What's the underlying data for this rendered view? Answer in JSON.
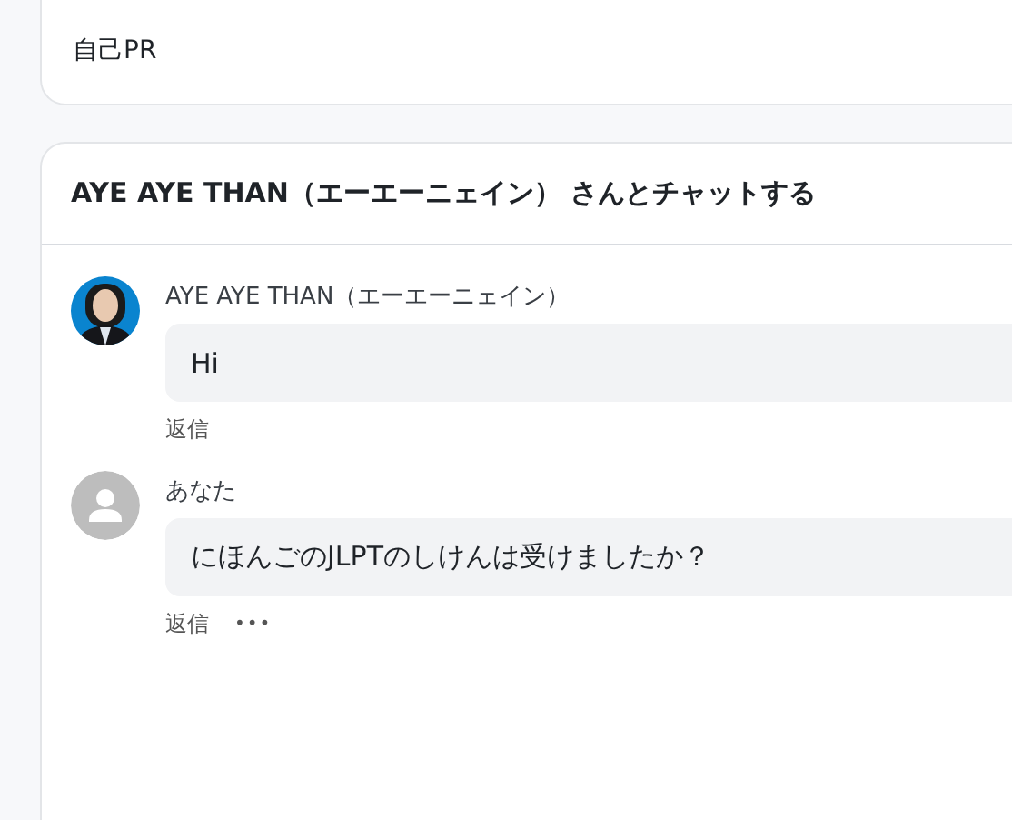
{
  "profile_card": {
    "title": "自己PR"
  },
  "chat": {
    "title": "AYE AYE THAN（エーエーニェイン） さんとチャットする",
    "messages": [
      {
        "author": "AYE AYE THAN（エーエーニェイン）",
        "text": "Hi",
        "actions": [
          {
            "kind": "reply",
            "label": "返信"
          }
        ]
      },
      {
        "kind": "default",
        "author": "あなた",
        "text": "にほんごのJLPTのしけんは受けましたか？",
        "actions": [
          {
            "kind": "reply",
            "label": "返信"
          },
          {
            "kind": "more",
            "label": "•••"
          }
        ]
      }
    ]
  }
}
